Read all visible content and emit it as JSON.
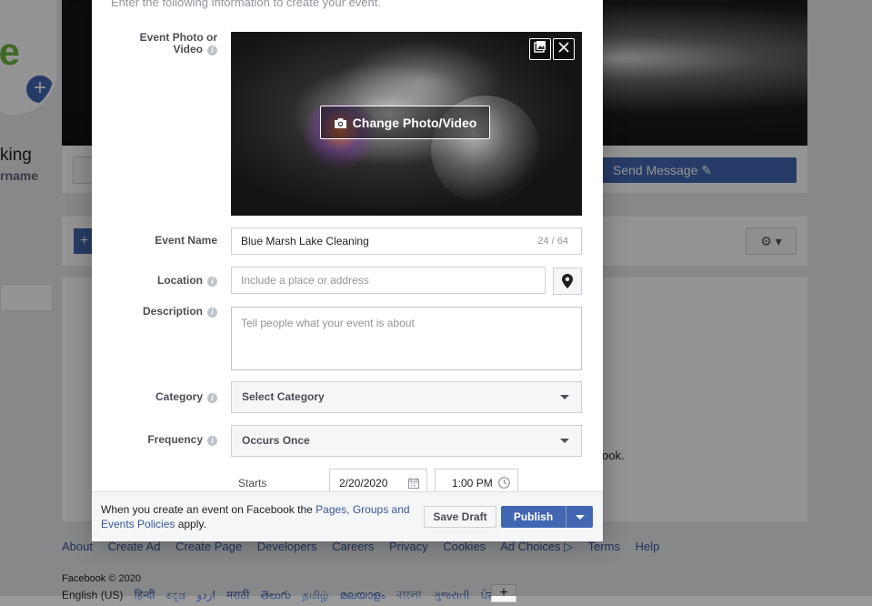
{
  "background": {
    "profile_name_fragment": "king",
    "username_fragment": "rname",
    "send_message_label": "Send Message ✎",
    "partial_text": "ook.",
    "footer_links": [
      "About",
      "Create Ad",
      "Create Page",
      "Developers",
      "Careers",
      "Privacy",
      "Cookies",
      "Ad Choices ▷",
      "Terms",
      "Help"
    ],
    "copyright": "Facebook © 2020",
    "current_language": "English (US)",
    "languages": [
      "हिन्दी",
      "ಕನ್ನಡ",
      "اردو",
      "मराठी",
      "తెలుగు",
      "தமிழ்",
      "മലയാളം",
      "বাংলা",
      "ગુજરાતી",
      "ਪੰਜਾਬੀ"
    ]
  },
  "modal": {
    "intro": "Enter the following information to create your event.",
    "photo": {
      "label": "Event Photo or Video",
      "change_label": "Change Photo/Video"
    },
    "event_name": {
      "label": "Event Name",
      "value": "Blue Marsh Lake Cleaning",
      "counter": "24 / 64"
    },
    "location": {
      "label": "Location",
      "placeholder": "Include a place or address"
    },
    "description": {
      "label": "Description",
      "placeholder": "Tell people what your event is about"
    },
    "category": {
      "label": "Category",
      "selected": "Select Category"
    },
    "frequency": {
      "label": "Frequency",
      "selected": "Occurs Once"
    },
    "starts": {
      "label": "Starts",
      "date": "2/20/2020",
      "time": "1:00 PM"
    },
    "footer": {
      "policy_prefix": "When you create an event on Facebook the ",
      "policy_link": "Pages, Groups and Events Policies",
      "policy_suffix": " apply.",
      "save_draft": "Save Draft",
      "publish": "Publish"
    }
  },
  "colors": {
    "accent": "#4267b2",
    "link": "#385898"
  }
}
